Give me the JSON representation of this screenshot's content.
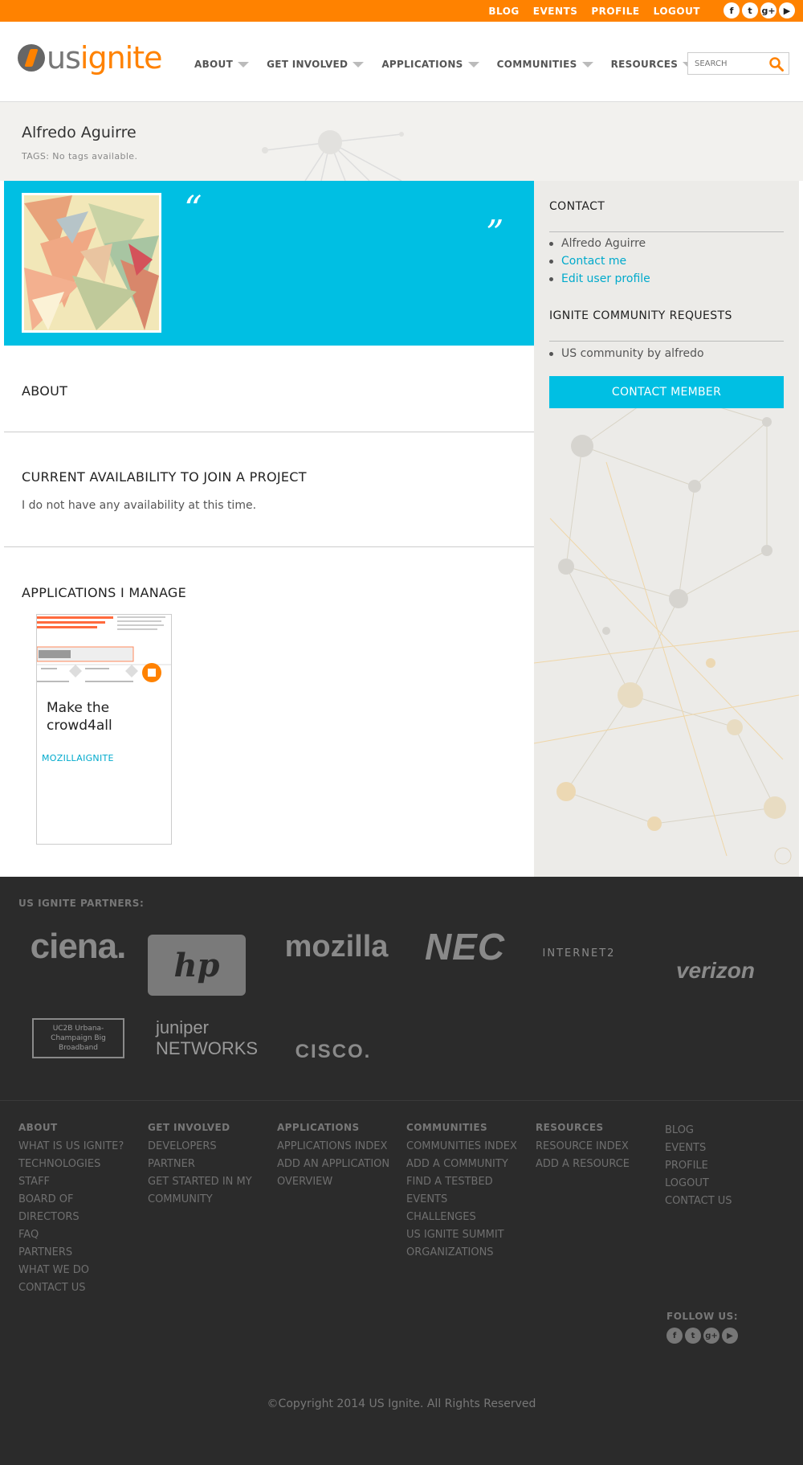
{
  "topnav": {
    "links": [
      "BLOG",
      "EVENTS",
      "PROFILE",
      "LOGOUT"
    ],
    "social": [
      "facebook-icon",
      "twitter-icon",
      "google-plus-icon",
      "youtube-icon"
    ]
  },
  "header": {
    "logo_us": "us",
    "logo_ignite": "ignite",
    "nav": [
      "ABOUT",
      "GET INVOLVED",
      "APPLICATIONS",
      "COMMUNITIES",
      "RESOURCES"
    ],
    "search_placeholder": "SEARCH"
  },
  "colors": {
    "accent": "#ff8200",
    "cyan": "#00bfe3",
    "footer": "#2b2b2b"
  },
  "profile": {
    "name": "Alfredo Aguirre",
    "tags": "TAGS: No tags available.",
    "quote_open": "“",
    "quote_close": "”"
  },
  "main": {
    "about_heading": "ABOUT",
    "availability_heading": "CURRENT AVAILABILITY TO JOIN A PROJECT",
    "availability_text": "I do not have any availability at this time.",
    "apps_heading": "APPLICATIONS I MANAGE",
    "app": {
      "title": "Make the crowd4all",
      "tag": "MOZILLAIGNITE"
    }
  },
  "sidebar": {
    "contact_heading": "CONTACT",
    "contact_items": [
      "Alfredo Aguirre",
      "Contact me",
      "Edit user profile"
    ],
    "requests_heading": "IGNITE COMMUNITY REQUESTS",
    "requests_items": [
      "US community by alfredo"
    ],
    "contact_button": "CONTACT MEMBER"
  },
  "footer": {
    "partners_heading": "US IGNITE PARTNERS:",
    "partners": [
      "ciena.",
      "hp",
      "mozilla",
      "NEC",
      "INTERNET2",
      "verizon",
      "UC2B Urbana-Champaign Big Broadband",
      "juniper NETWORKS",
      "CISCO."
    ],
    "columns": [
      {
        "heading": "ABOUT",
        "items": [
          "WHAT IS US IGNITE?",
          "TECHNOLOGIES",
          "STAFF",
          "BOARD OF DIRECTORS",
          "FAQ",
          "PARTNERS",
          "WHAT WE DO",
          "CONTACT US"
        ]
      },
      {
        "heading": "GET INVOLVED",
        "items": [
          "DEVELOPERS",
          "PARTNER",
          "GET STARTED IN MY COMMUNITY"
        ]
      },
      {
        "heading": "APPLICATIONS",
        "items": [
          "APPLICATIONS INDEX",
          "ADD AN APPLICATION",
          "OVERVIEW"
        ]
      },
      {
        "heading": "COMMUNITIES",
        "items": [
          "COMMUNITIES INDEX",
          "ADD A COMMUNITY",
          "FIND A TESTBED",
          "EVENTS",
          "CHALLENGES",
          "US IGNITE SUMMIT",
          "ORGANIZATIONS"
        ]
      },
      {
        "heading": "RESOURCES",
        "items": [
          "RESOURCE INDEX",
          "ADD A RESOURCE"
        ]
      },
      {
        "heading": "",
        "items": [
          "BLOG",
          "EVENTS",
          "PROFILE",
          "LOGOUT",
          "CONTACT US"
        ]
      }
    ],
    "follow_heading": "FOLLOW US:",
    "copyright": "©Copyright 2014 US Ignite. All Rights Reserved"
  }
}
